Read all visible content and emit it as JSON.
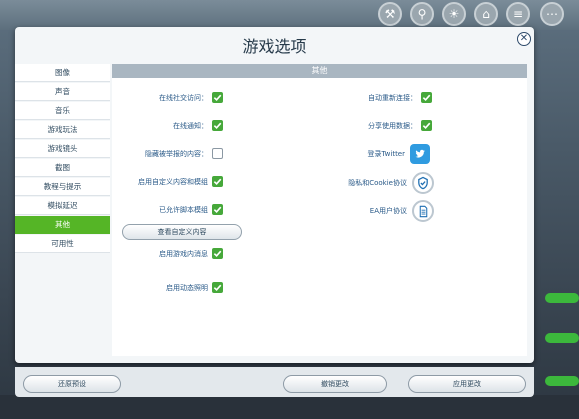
{
  "dialog": {
    "title": "游戏选项",
    "close": "✕",
    "section_header": "其他"
  },
  "sidebar": {
    "items": [
      {
        "label": "图像"
      },
      {
        "label": "声音"
      },
      {
        "label": "音乐"
      },
      {
        "label": "游戏玩法"
      },
      {
        "label": "游戏镜头"
      },
      {
        "label": "截图"
      },
      {
        "label": "教程与提示"
      },
      {
        "label": "模拟延迟"
      },
      {
        "label": "其他",
        "active": true
      },
      {
        "label": "可用性"
      }
    ]
  },
  "options_left": [
    {
      "label": "在线社交访问：",
      "checked": true
    },
    {
      "label": "在线通知：",
      "checked": true
    },
    {
      "label": "隐藏被举报的内容：",
      "checked": false
    },
    {
      "label": "启用自定义内容和模组",
      "checked": true
    },
    {
      "label": "已允许脚本模组",
      "checked": true
    },
    {
      "label": "启用游戏内消息",
      "checked": true
    },
    {
      "label": "启用动态照明",
      "checked": true
    }
  ],
  "view_custom_content_button": "查看自定义内容",
  "options_right": [
    {
      "label": "自动重新连接：",
      "checked": true
    },
    {
      "label": "分享使用数据：",
      "checked": true
    }
  ],
  "links_right": [
    {
      "label": "登录Twitter",
      "icon": "twitter-icon"
    },
    {
      "label": "隐私和Cookie协议",
      "icon": "shield-check-icon"
    },
    {
      "label": "EA用户协议",
      "icon": "document-icon"
    }
  ],
  "footer": {
    "defaults_button": "还原预设",
    "cancel_button": "撤销更改",
    "apply_button": "应用更改"
  },
  "colors": {
    "accent_green": "#55b526",
    "check_green": "#46a83a",
    "link_blue": "#2a5a88",
    "twitter_blue": "#2f9be0"
  }
}
